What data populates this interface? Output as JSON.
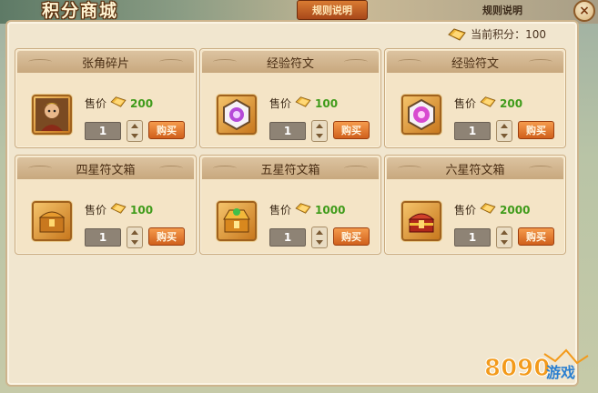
{
  "window": {
    "title": "积分商城",
    "rules_label": "规则说明",
    "top_right_text": "规则说明",
    "close_label": "×"
  },
  "points": {
    "label": "当前积分：100",
    "icon": "ticket-coin-icon"
  },
  "price_label": "售价",
  "buy_label": "购买",
  "items": [
    {
      "name": "张角碎片",
      "price": "200",
      "qty": "1",
      "icon": "hero-portrait-icon"
    },
    {
      "name": "经验符文",
      "price": "100",
      "qty": "1",
      "icon": "rune-purple-icon"
    },
    {
      "name": "经验符文",
      "price": "200",
      "qty": "1",
      "icon": "rune-pink-icon"
    },
    {
      "name": "四星符文箱",
      "price": "100",
      "qty": "1",
      "icon": "chest-bronze-icon"
    },
    {
      "name": "五星符文箱",
      "price": "1000",
      "qty": "1",
      "icon": "chest-gold-icon"
    },
    {
      "name": "六星符文箱",
      "price": "2000",
      "qty": "1",
      "icon": "chest-red-icon"
    }
  ],
  "watermark": {
    "text": "8090游戏"
  },
  "colors": {
    "price": "#3f9b1a",
    "buy_button": "#e0782c",
    "panel": "#f1e6cf"
  }
}
